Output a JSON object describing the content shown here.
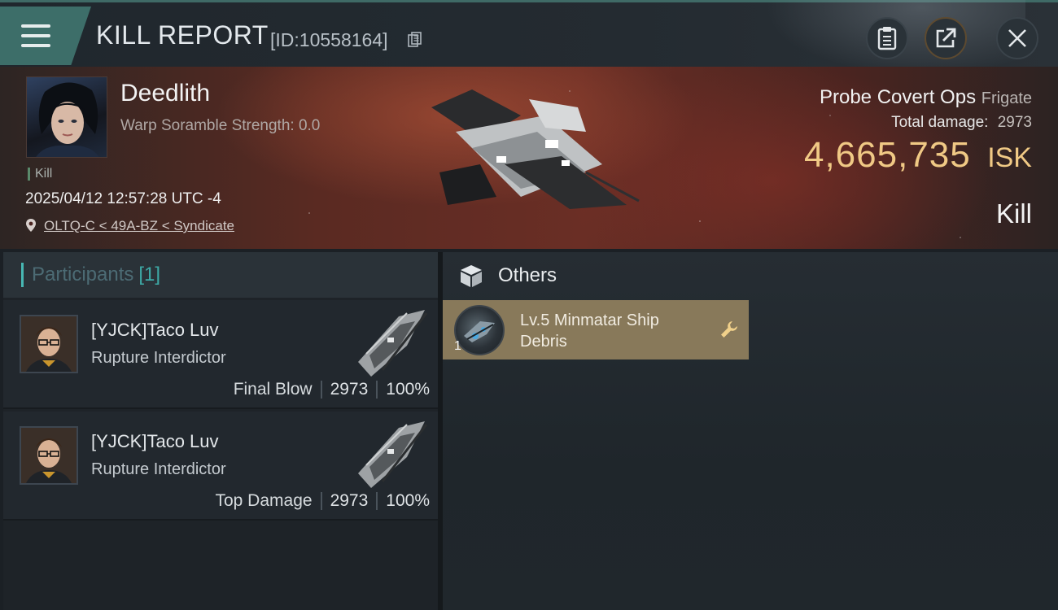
{
  "header": {
    "title": "KILL REPORT",
    "report_id": "[ID:10558164]"
  },
  "victim": {
    "name": "Deedlith",
    "warp_scramble": "Warp Soramble Strength: 0.0",
    "kill_tag": "Kill",
    "timestamp": "2025/04/12 12:57:28 UTC -4",
    "location": "OLTQ-C < 49A-BZ < Syndicate",
    "ship_name": "Probe Covert Ops",
    "ship_class": "Frigate",
    "total_damage_label": "Total damage:",
    "total_damage": "2973",
    "isk_value": "4,665,735",
    "isk_unit": "ISK",
    "result": "Kill"
  },
  "participants": {
    "title": "Participants",
    "count": "[1]",
    "rows": [
      {
        "name": "[YJCK]Taco Luv",
        "ship": "Rupture Interdictor",
        "role": "Final Blow",
        "damage": "2973",
        "percent": "100%"
      },
      {
        "name": "[YJCK]Taco Luv",
        "ship": "Rupture Interdictor",
        "role": "Top Damage",
        "damage": "2973",
        "percent": "100%"
      }
    ]
  },
  "others": {
    "title": "Others",
    "items": [
      {
        "name": "Lv.5 Minmatar Ship Debris",
        "quantity": "1"
      }
    ]
  },
  "colors": {
    "accent_teal": "#3d6e69",
    "isk_gold": "#f0c985",
    "item_card": "#88795a",
    "count_teal": "#3ea9a6"
  },
  "icons": [
    "menu-icon",
    "copy-icon",
    "clipboard-icon",
    "share-icon",
    "close-icon",
    "location-pin-icon",
    "box-icon",
    "wrench-icon"
  ]
}
